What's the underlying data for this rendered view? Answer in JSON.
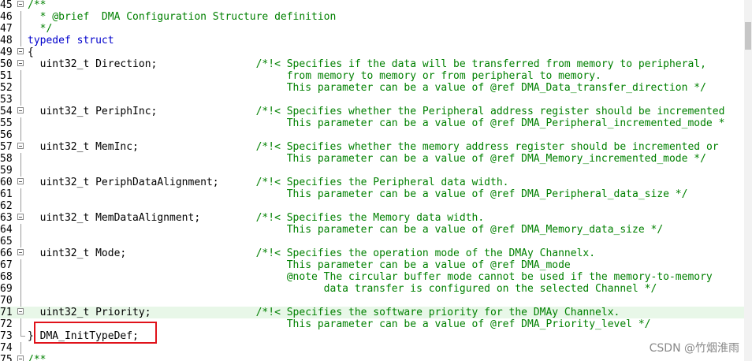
{
  "editor": {
    "lines": [
      {
        "num": "45",
        "code": "/**",
        "cls": "cmt"
      },
      {
        "num": "46",
        "code": "  * @brief  DMA Configuration Structure definition",
        "cls": "cmt"
      },
      {
        "num": "47",
        "code": "  */",
        "cls": "cmt"
      },
      {
        "num": "48",
        "code": "typedef struct",
        "cls": "kw"
      },
      {
        "num": "49",
        "code": "{",
        "cls": "sym"
      },
      {
        "num": "50",
        "code": "  uint32_t Direction;                /*!< Specifies if the data will be transferred from memory to peripheral,",
        "cls": "mix"
      },
      {
        "num": "51",
        "code": "                                          from memory to memory or from peripheral to memory.",
        "cls": "cmt"
      },
      {
        "num": "52",
        "code": "                                          This parameter can be a value of @ref DMA_Data_transfer_direction */",
        "cls": "cmt"
      },
      {
        "num": "53",
        "code": "",
        "cls": "cmt"
      },
      {
        "num": "54",
        "code": "  uint32_t PeriphInc;                /*!< Specifies whether the Peripheral address register should be incremented",
        "cls": "mix"
      },
      {
        "num": "55",
        "code": "                                          This parameter can be a value of @ref DMA_Peripheral_incremented_mode *",
        "cls": "cmt"
      },
      {
        "num": "56",
        "code": "",
        "cls": "cmt"
      },
      {
        "num": "57",
        "code": "  uint32_t MemInc;                   /*!< Specifies whether the memory address register should be incremented or",
        "cls": "mix"
      },
      {
        "num": "58",
        "code": "                                          This parameter can be a value of @ref DMA_Memory_incremented_mode */",
        "cls": "cmt"
      },
      {
        "num": "59",
        "code": "",
        "cls": "cmt"
      },
      {
        "num": "60",
        "code": "  uint32_t PeriphDataAlignment;      /*!< Specifies the Peripheral data width.",
        "cls": "mix"
      },
      {
        "num": "61",
        "code": "                                          This parameter can be a value of @ref DMA_Peripheral_data_size */",
        "cls": "cmt"
      },
      {
        "num": "62",
        "code": "",
        "cls": "cmt"
      },
      {
        "num": "63",
        "code": "  uint32_t MemDataAlignment;         /*!< Specifies the Memory data width.",
        "cls": "mix"
      },
      {
        "num": "64",
        "code": "                                          This parameter can be a value of @ref DMA_Memory_data_size */",
        "cls": "cmt"
      },
      {
        "num": "65",
        "code": "",
        "cls": "cmt"
      },
      {
        "num": "66",
        "code": "  uint32_t Mode;                     /*!< Specifies the operation mode of the DMAy Channelx.",
        "cls": "mix"
      },
      {
        "num": "67",
        "code": "                                          This parameter can be a value of @ref DMA_mode",
        "cls": "cmt"
      },
      {
        "num": "68",
        "code": "                                          @note The circular buffer mode cannot be used if the memory-to-memory",
        "cls": "cmt"
      },
      {
        "num": "69",
        "code": "                                                data transfer is configured on the selected Channel */",
        "cls": "cmt"
      },
      {
        "num": "70",
        "code": "",
        "cls": "cmt"
      },
      {
        "num": "71",
        "code": "  uint32_t Priority;                 /*!< Specifies the software priority for the DMAy Channelx.",
        "cls": "mix"
      },
      {
        "num": "72",
        "code": "                                          This parameter can be a value of @ref DMA_Priority_level */",
        "cls": "cmt"
      },
      {
        "num": "73",
        "code": "} DMA_InitTypeDef;",
        "cls": "sym"
      },
      {
        "num": "74",
        "code": "",
        "cls": "cmt"
      },
      {
        "num": "75",
        "code": "/**",
        "cls": "cmt"
      }
    ]
  },
  "watermark": "CSDN @竹烟淮雨"
}
